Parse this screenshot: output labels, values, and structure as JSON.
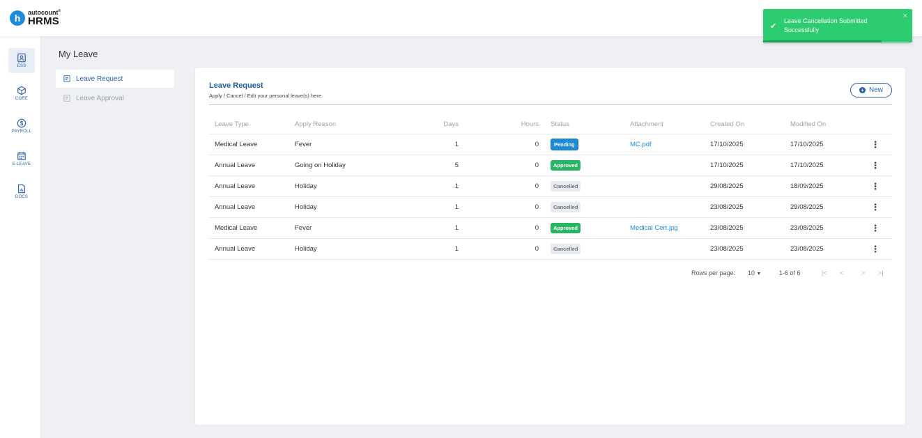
{
  "brand": {
    "logo_letter": "h",
    "company": "autocount",
    "product": "HRMS"
  },
  "sidebar": {
    "items": [
      {
        "label": "ESS",
        "icon": "person-card-icon"
      },
      {
        "label": "CORE",
        "icon": "cube-icon"
      },
      {
        "label": "PAYROLL",
        "icon": "dollar-circle-icon"
      },
      {
        "label": "E-LEAVE",
        "icon": "calendar-icon"
      },
      {
        "label": "DOCS",
        "icon": "document-chart-icon"
      }
    ]
  },
  "page": {
    "title": "My Leave"
  },
  "subnav": {
    "items": [
      {
        "label": "Leave Request",
        "active": true
      },
      {
        "label": "Leave Approval",
        "active": false
      }
    ]
  },
  "card": {
    "title": "Leave Request",
    "subtitle": "Apply / Cancel / Edit your personal leave(s) here.",
    "new_button": "New"
  },
  "table": {
    "headers": {
      "leave_type": "Leave Type",
      "apply_reason": "Apply Reason",
      "days": "Days",
      "hours": "Hours",
      "status": "Status",
      "attachment": "Attachment",
      "created_on": "Created On",
      "modified_on": "Modified On"
    },
    "rows": [
      {
        "leave_type": "Medical Leave",
        "apply_reason": "Fever",
        "days": "1",
        "hours": "0",
        "status": "Pending",
        "attachment": "MC.pdf",
        "created_on": "17/10/2025",
        "modified_on": "17/10/2025"
      },
      {
        "leave_type": "Annual Leave",
        "apply_reason": "Going on Holiday",
        "days": "5",
        "hours": "0",
        "status": "Approved",
        "attachment": "",
        "created_on": "17/10/2025",
        "modified_on": "17/10/2025"
      },
      {
        "leave_type": "Annual Leave",
        "apply_reason": "Holiday",
        "days": "1",
        "hours": "0",
        "status": "Cancelled",
        "attachment": "",
        "created_on": "29/08/2025",
        "modified_on": "18/09/2025"
      },
      {
        "leave_type": "Annual Leave",
        "apply_reason": "Holiday",
        "days": "1",
        "hours": "0",
        "status": "Cancelled",
        "attachment": "",
        "created_on": "23/08/2025",
        "modified_on": "29/08/2025"
      },
      {
        "leave_type": "Medical Leave",
        "apply_reason": "Fever",
        "days": "1",
        "hours": "0",
        "status": "Approved",
        "attachment": "Medical Cert.jpg",
        "created_on": "23/08/2025",
        "modified_on": "23/08/2025"
      },
      {
        "leave_type": "Annual Leave",
        "apply_reason": "Holiday",
        "days": "1",
        "hours": "0",
        "status": "Cancelled",
        "attachment": "",
        "created_on": "23/08/2025",
        "modified_on": "23/08/2025"
      }
    ]
  },
  "pagination": {
    "rows_per_page_label": "Rows per page:",
    "rows_per_page_value": "10",
    "range": "1-6 of 6",
    "first": "|<",
    "prev": "<",
    "next": ">",
    "last": ">|"
  },
  "toast": {
    "message": "Leave Cancellation Submitted Successfully",
    "close": "×",
    "check": "✔",
    "color": "#2ecc71"
  },
  "colors": {
    "accent": "#2a5fa8",
    "link": "#1f8ad8",
    "pending": "#1f8ad8",
    "approved": "#28b463",
    "cancelled": "#e8eaed"
  }
}
